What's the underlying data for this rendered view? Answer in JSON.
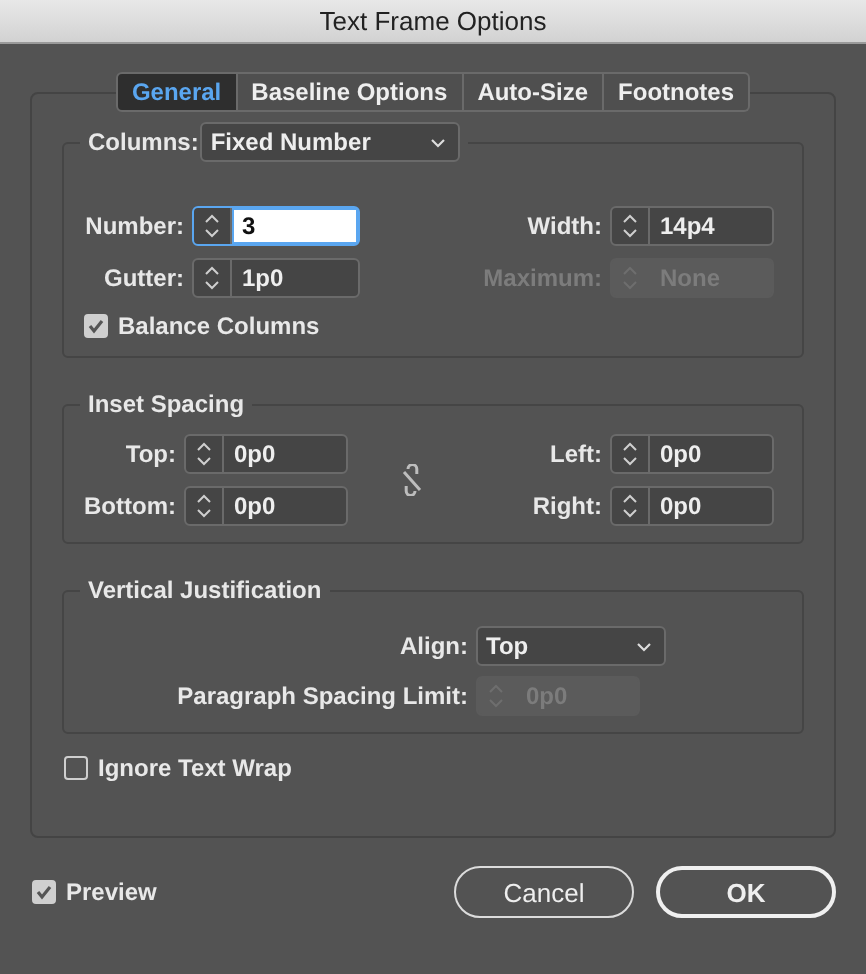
{
  "window": {
    "title": "Text Frame Options"
  },
  "tabs": [
    {
      "label": "General",
      "selected": true
    },
    {
      "label": "Baseline Options",
      "selected": false
    },
    {
      "label": "Auto-Size",
      "selected": false
    },
    {
      "label": "Footnotes",
      "selected": false
    }
  ],
  "columns": {
    "label": "Columns:",
    "mode": "Fixed Number",
    "left_fields": [
      {
        "label": "Number:",
        "value": "3",
        "focused": true,
        "disabled": false
      },
      {
        "label": "Gutter:",
        "value": "1p0",
        "focused": false,
        "disabled": false
      }
    ],
    "right_fields": [
      {
        "label": "Width:",
        "value": "14p4",
        "focused": false,
        "disabled": false
      },
      {
        "label": "Maximum:",
        "value": "None",
        "focused": false,
        "disabled": true
      }
    ],
    "balance": {
      "label": "Balance Columns",
      "checked": true
    }
  },
  "inset_spacing": {
    "title": "Inset Spacing",
    "left_fields": [
      {
        "label": "Top:",
        "value": "0p0",
        "focused": false,
        "disabled": false
      },
      {
        "label": "Bottom:",
        "value": "0p0",
        "focused": false,
        "disabled": false
      }
    ],
    "right_fields": [
      {
        "label": "Left:",
        "value": "0p0",
        "focused": false,
        "disabled": false
      },
      {
        "label": "Right:",
        "value": "0p0",
        "focused": false,
        "disabled": false
      }
    ]
  },
  "vertical_justification": {
    "title": "Vertical Justification",
    "align": {
      "label": "Align:",
      "value": "Top"
    },
    "spacing_limit": {
      "label": "Paragraph Spacing Limit:",
      "value": "0p0",
      "focused": false,
      "disabled": true
    }
  },
  "ignore_text_wrap": {
    "label": "Ignore Text Wrap",
    "checked": false
  },
  "preview": {
    "label": "Preview",
    "checked": true
  },
  "buttons": [
    {
      "label": "Cancel",
      "default": false
    },
    {
      "label": "OK",
      "default": true
    }
  ]
}
